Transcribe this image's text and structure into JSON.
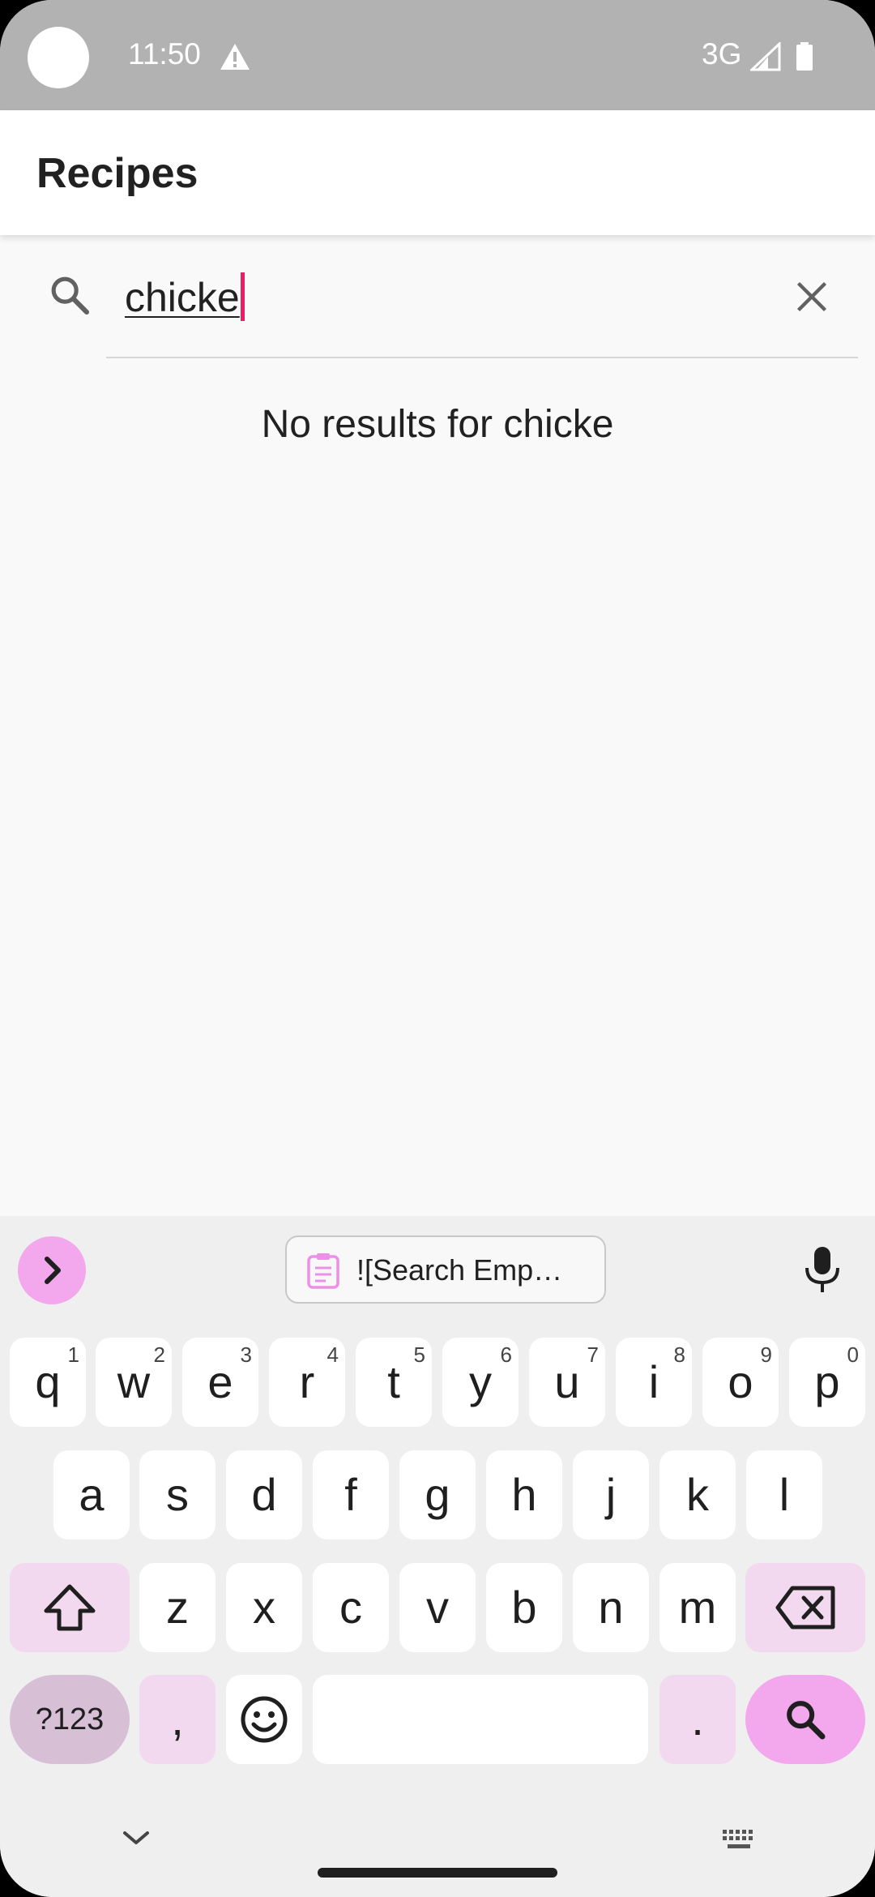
{
  "status_bar": {
    "time": "11:50",
    "network": "3G",
    "icons": [
      "warning-icon",
      "signal-icon",
      "battery-icon"
    ]
  },
  "app_bar": {
    "title": "Recipes"
  },
  "search": {
    "query": "chicke",
    "icons": [
      "search-icon",
      "close-icon"
    ]
  },
  "results": {
    "empty_message": "No results for chicke"
  },
  "keyboard": {
    "clipboard_suggestion": "![Search Emp…",
    "row1": [
      {
        "label": "q",
        "hint": "1"
      },
      {
        "label": "w",
        "hint": "2"
      },
      {
        "label": "e",
        "hint": "3"
      },
      {
        "label": "r",
        "hint": "4"
      },
      {
        "label": "t",
        "hint": "5"
      },
      {
        "label": "y",
        "hint": "6"
      },
      {
        "label": "u",
        "hint": "7"
      },
      {
        "label": "i",
        "hint": "8"
      },
      {
        "label": "o",
        "hint": "9"
      },
      {
        "label": "p",
        "hint": "0"
      }
    ],
    "row2": [
      "a",
      "s",
      "d",
      "f",
      "g",
      "h",
      "j",
      "k",
      "l"
    ],
    "row3": [
      "z",
      "x",
      "c",
      "v",
      "b",
      "n",
      "m"
    ],
    "symbols_label": "?123",
    "comma_label": ",",
    "period_label": ".",
    "colors": {
      "accent": "#f3a8ee",
      "secondary": "#f3d9ef",
      "cursor": "#e91e63"
    }
  }
}
